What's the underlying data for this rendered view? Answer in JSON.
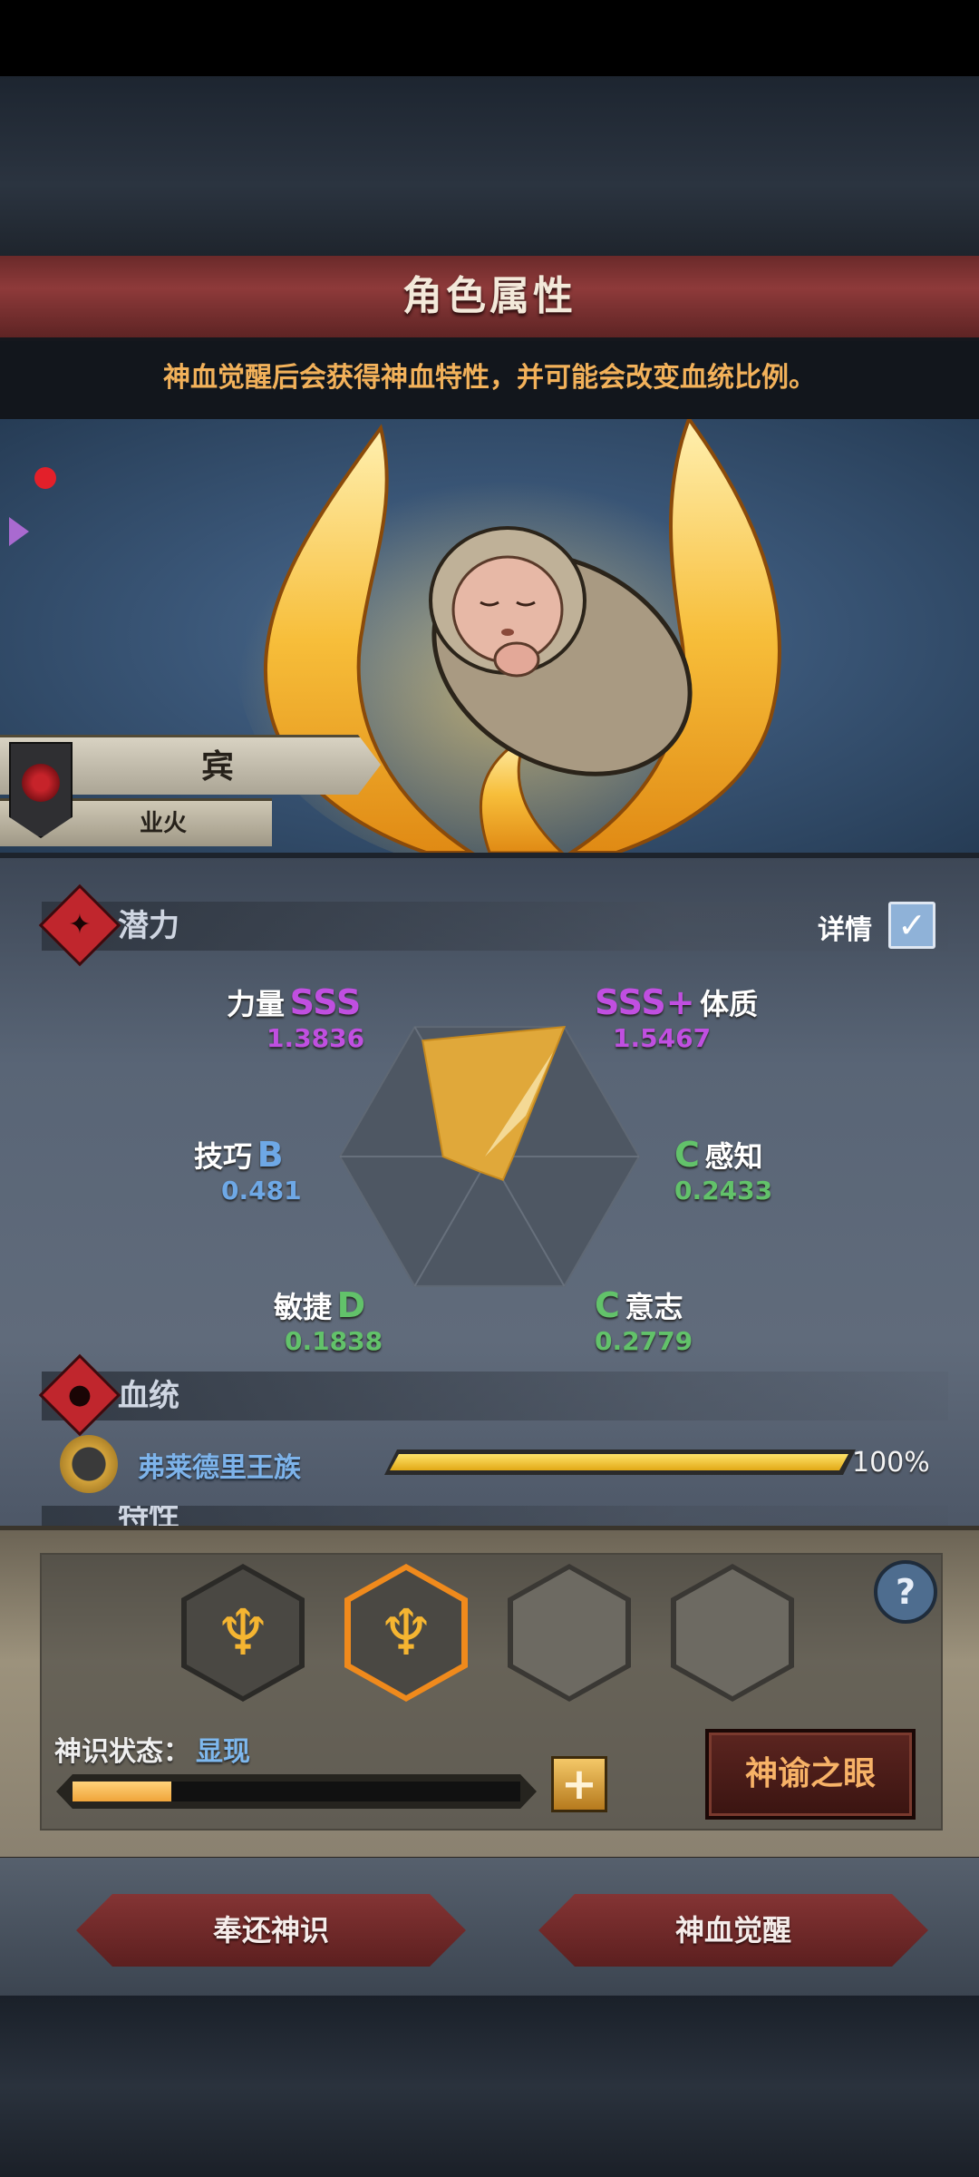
{
  "header": {
    "title": "角色属性",
    "subtitle": "神血觉醒后会获得神血特性，并可能会改变血统比例。"
  },
  "character": {
    "name": "宾",
    "tag": "业火"
  },
  "potential": {
    "section_label": "潜力",
    "detail_label": "详情",
    "detail_checked": true,
    "stats": [
      {
        "name": "力量",
        "grade": "SSS",
        "value": "1.3836",
        "color": "#c04fe0"
      },
      {
        "name": "体质",
        "grade": "SSS+",
        "value": "1.5467",
        "color": "#c04fe0"
      },
      {
        "name": "技巧",
        "grade": "B",
        "value": "0.481",
        "color": "#6ea8e6"
      },
      {
        "name": "感知",
        "grade": "C",
        "value": "0.2433",
        "color": "#62c26a"
      },
      {
        "name": "敏捷",
        "grade": "D",
        "value": "0.1838",
        "color": "#62c26a"
      },
      {
        "name": "意志",
        "grade": "C",
        "value": "0.2779",
        "color": "#62c26a"
      }
    ]
  },
  "bloodline": {
    "section_label": "血统",
    "name": "弗莱德里王族",
    "percent_text": "100%",
    "fraction": 1.0
  },
  "next_section": {
    "label": "特性"
  },
  "divine_sense": {
    "state_label": "神识状态：",
    "state_value": "显现",
    "progress_fraction": 0.22,
    "oracle_button": "神谕之眼",
    "plus_icon": "plus-icon",
    "help_icon": "question-icon"
  },
  "footer": {
    "return_button": "奉还神识",
    "awaken_button": "神血觉醒"
  },
  "colors": {
    "accent_gold": "#f5b531",
    "title_red": "#8e3a3a",
    "radar_fill": "#e0a83a"
  }
}
